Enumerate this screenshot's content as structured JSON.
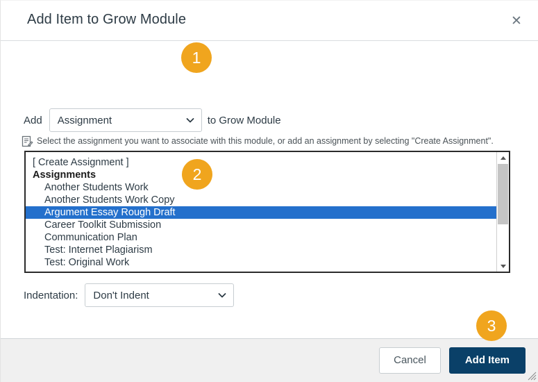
{
  "dialog": {
    "title": "Add Item to Grow Module",
    "close_icon_label": "✕"
  },
  "form": {
    "add_label": "Add",
    "item_type_value": "Assignment",
    "after_label": "to Grow Module",
    "hint_text": "Select the assignment you want to associate with this module, or add an assignment by selecting \"Create Assignment\".",
    "indentation_label": "Indentation:",
    "indentation_value": "Don't Indent"
  },
  "listbox": {
    "options": [
      {
        "label": "[ Create Assignment ]",
        "type": "item",
        "selected": false
      },
      {
        "label": "Assignments",
        "type": "group",
        "selected": false
      },
      {
        "label": "Another Students Work",
        "type": "child",
        "selected": false
      },
      {
        "label": "Another Students Work Copy",
        "type": "child",
        "selected": false
      },
      {
        "label": "Argument Essay Rough Draft",
        "type": "child",
        "selected": true
      },
      {
        "label": "Career Toolkit Submission",
        "type": "child",
        "selected": false
      },
      {
        "label": "Communication Plan",
        "type": "child",
        "selected": false
      },
      {
        "label": "Test: Internet Plagiarism",
        "type": "child",
        "selected": false
      },
      {
        "label": "Test: Original Work",
        "type": "child",
        "selected": false
      }
    ],
    "selected_value": "Argument Essay Rough Draft"
  },
  "footer": {
    "cancel_label": "Cancel",
    "submit_label": "Add Item"
  },
  "annotations": [
    {
      "number": "1"
    },
    {
      "number": "2"
    },
    {
      "number": "3"
    }
  ],
  "colors": {
    "badge": "#F0A51E",
    "selection": "#2470CC",
    "primary_button": "#0A4068",
    "footer_bg": "#F0F0F0"
  }
}
